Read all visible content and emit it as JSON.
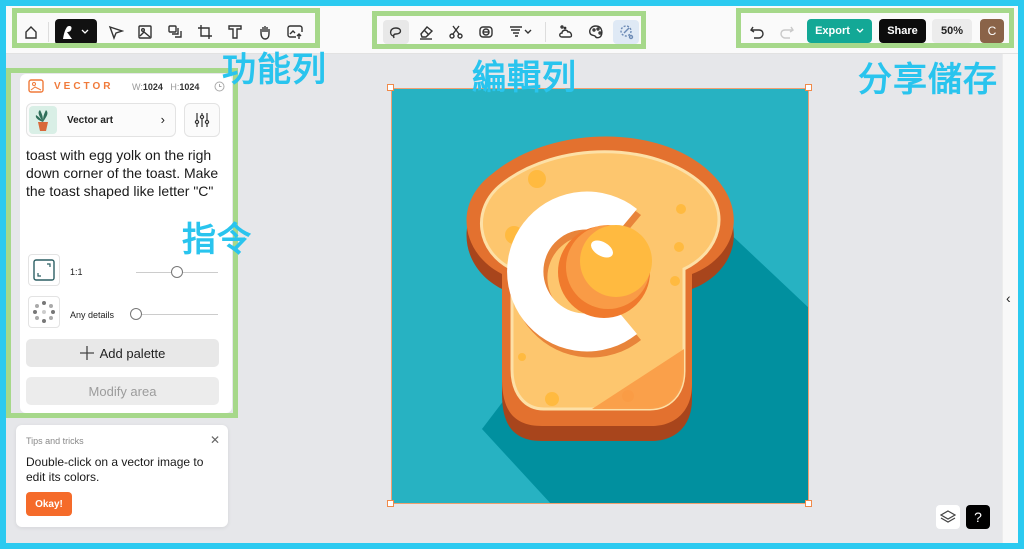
{
  "toolbar": {
    "tools": [
      {
        "name": "home",
        "icon": "home-icon"
      },
      {
        "name": "brush",
        "icon": "brush-icon"
      },
      {
        "name": "select",
        "icon": "cursor-icon"
      },
      {
        "name": "image-frame",
        "icon": "image-frame-icon"
      },
      {
        "name": "layers-stack",
        "icon": "stack-icon"
      },
      {
        "name": "crop",
        "icon": "crop-icon"
      },
      {
        "name": "text",
        "icon": "text-icon"
      },
      {
        "name": "hand",
        "icon": "hand-icon"
      },
      {
        "name": "upload-image",
        "icon": "upload-image-icon"
      }
    ]
  },
  "editbar": {
    "tools": [
      {
        "name": "lasso",
        "icon": "lasso-icon"
      },
      {
        "name": "eraser",
        "icon": "eraser-icon"
      },
      {
        "name": "cut",
        "icon": "scissors-icon"
      },
      {
        "name": "vectorize",
        "icon": "vectorize-icon"
      },
      {
        "name": "tornado",
        "icon": "tornado-icon"
      },
      {
        "name": "cloud",
        "icon": "cloud-icon"
      },
      {
        "name": "palette",
        "icon": "palette-icon"
      },
      {
        "name": "magic-edit",
        "icon": "magic-edit-icon"
      }
    ]
  },
  "share": {
    "undo_icon": "undo-icon",
    "redo_icon": "redo-icon",
    "export_label": "Export",
    "share_label": "Share",
    "zoom_level": "50%",
    "avatar_initial": "C"
  },
  "annotations": {
    "toolbar": "功能列",
    "editbar": "編輯列",
    "share": "分享儲存",
    "prompt": "指令"
  },
  "panel": {
    "mode_label": "VECTOR",
    "width_label": "W:",
    "width_value": "1024",
    "height_label": "H:",
    "height_value": "1024",
    "style_name": "Vector art",
    "prompt": "toast with egg yolk on the righ down corner of the toast. Make the toast shaped like letter \"C\"",
    "aspect_label": "1:1",
    "aspect_slider": 0.5,
    "detail_label": "Any details",
    "detail_slider": 0.0,
    "add_palette_label": "Add palette",
    "modify_area_label": "Modify area"
  },
  "tips": {
    "title": "Tips and tricks",
    "body": "Double-click on a vector image to edit its colors.",
    "ok_label": "Okay!"
  },
  "colors": {
    "accent_export": "#13a896",
    "accent_orange": "#f56b2a",
    "annotation_blue": "#29c4ee",
    "highlight_green": "#a6d88a",
    "canvas_bg": "#27b2c2"
  }
}
